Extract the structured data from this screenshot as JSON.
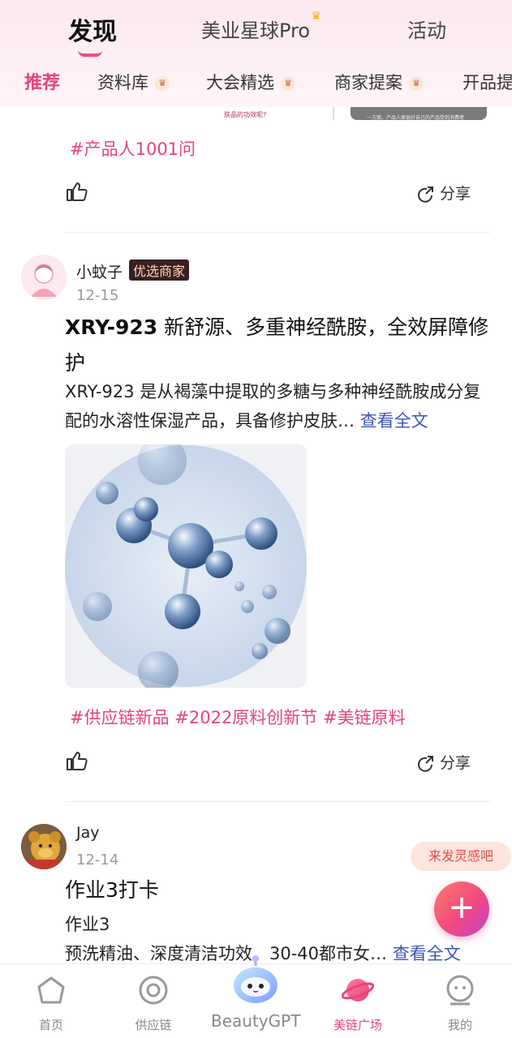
{
  "header": {
    "tabs": [
      {
        "label": "发现",
        "active": true
      },
      {
        "label": "美业星球Pro"
      },
      {
        "label": "活动"
      }
    ],
    "sub_tabs": [
      {
        "label": "推荐",
        "active": true
      },
      {
        "label": "资料库",
        "badge": true
      },
      {
        "label": "大会精选",
        "badge": true
      },
      {
        "label": "商家提案",
        "badge": true
      },
      {
        "label": "开品提"
      }
    ]
  },
  "prev_post": {
    "caption": "肤品的功效呢?",
    "dark_caption": "一方面，产品人面很好自己的产品受到消费者",
    "tags": "#产品人1001问",
    "share": "分享"
  },
  "posts": [
    {
      "author": "小蚊子",
      "badge": "优选商家",
      "date": "12-15",
      "title_code": "XRY-923",
      "title_rest": " 新舒源、多重神经酰胺，全效屏障修护",
      "body": "XRY-923 是从褐藻中提取的多糖与多种神经酰胺成分复配的水溶性保湿产品，具备修护皮肤… ",
      "more": "查看全文",
      "tags": "#供应链新品 #2022原料创新节 #美链原料",
      "share": "分享"
    },
    {
      "author": "Jay",
      "date": "12-14",
      "title": "作业3打卡",
      "body_line1": "作业3",
      "body_line2": "预洗精油、深度清洁功效、30-40都市女… ",
      "more": "查看全文"
    }
  ],
  "floating": {
    "tip": "来发灵感吧",
    "plus": "+"
  },
  "bottom_nav": [
    {
      "label": "首页",
      "icon": "home-icon"
    },
    {
      "label": "供应链",
      "icon": "supply-icon"
    },
    {
      "label": "BeautyGPT",
      "icon": "beautygpt-mascot-icon"
    },
    {
      "label": "美链广场",
      "icon": "planet-icon",
      "active": true
    },
    {
      "label": "我的",
      "icon": "profile-icon"
    }
  ],
  "colors": {
    "accent": "#e8437a",
    "link": "#3c55b8",
    "merchant_badge_bg": "#3a1f22"
  }
}
